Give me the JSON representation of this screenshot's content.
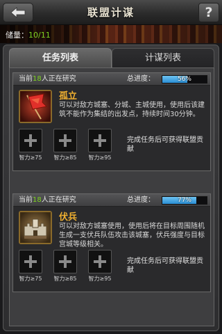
{
  "header": {
    "title": "联盟计谋",
    "help_label": "?"
  },
  "banner": {
    "storage_label": "储量：",
    "storage_count": "10/11"
  },
  "tabs": [
    {
      "label": "任务列表",
      "active": true
    },
    {
      "label": "计谋列表",
      "active": false
    }
  ],
  "tasks": [
    {
      "researching_prefix": "当前",
      "researching_count": "18",
      "researching_suffix": "人正在研究",
      "progress_label": "总进度：",
      "progress_text": "56%",
      "progress_value": 56,
      "name": "孤立",
      "description": "可以对敌方城塞、分城、主城使用，使用后该建筑不能作为集结的出发点，持续时间30分钟。",
      "slots": [
        {
          "label": "智力≥75"
        },
        {
          "label": "智力≥85"
        },
        {
          "label": "智力≥95"
        }
      ],
      "reward": "完成任务后可获得联盟贡献",
      "icon": "red-flag-icon"
    },
    {
      "researching_prefix": "当前",
      "researching_count": "18",
      "researching_suffix": "人正在研究",
      "progress_label": "总进度：",
      "progress_text": "77%",
      "progress_value": 77,
      "name": "伏兵",
      "description": "可以对敌方城塞使用，使用后将在目标周围随机生成一支伏兵队伍攻击该城塞，伏兵强度与目标宫城等级相关。",
      "slots": [
        {
          "label": "智力≥75"
        },
        {
          "label": "智力≥85"
        },
        {
          "label": "智力≥95"
        }
      ],
      "reward": "完成任务后可获得联盟贡献",
      "icon": "fortress-icon"
    }
  ],
  "colors": {
    "accent_green": "#7ed321",
    "skill_name": "#f0b030",
    "progress_fill": "#2a8ed4"
  }
}
